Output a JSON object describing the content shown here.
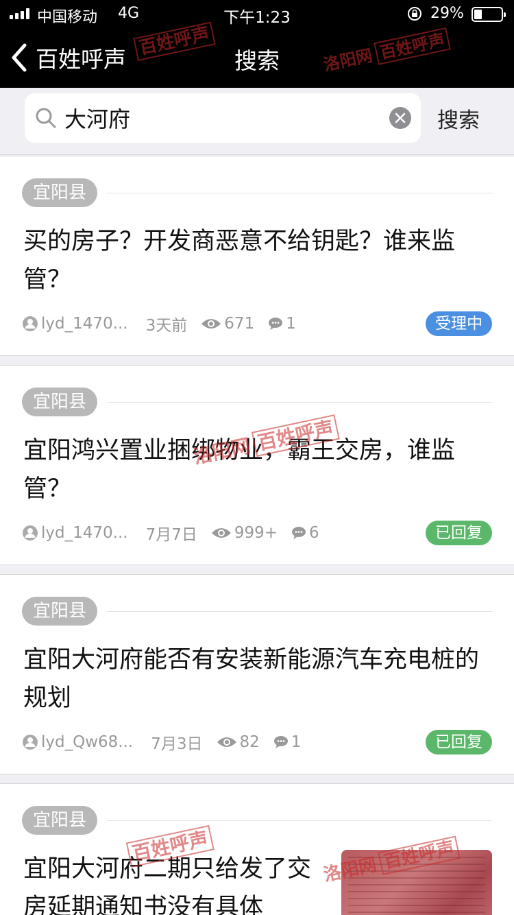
{
  "status_bar": {
    "carrier": "中国移动",
    "network": "4G",
    "time": "下午1:23",
    "battery": "29%",
    "battery_level": 0.29
  },
  "nav": {
    "back_label": "百姓呼声",
    "title": "搜索"
  },
  "search": {
    "query": "大河府",
    "submit_label": "搜索"
  },
  "posts": [
    {
      "region": "宜阳县",
      "title": "买的房子？开发商恶意不给钥匙？谁来监管？",
      "author": "lyd_1470...",
      "time": "3天前",
      "views": "671",
      "comments": "1",
      "status": "受理中",
      "status_color": "#4a8fe0"
    },
    {
      "region": "宜阳县",
      "title": "宜阳鸿兴置业捆绑物业，霸王交房，谁监管？",
      "author": "lyd_1470...",
      "time": "7月7日",
      "views": "999+",
      "comments": "6",
      "status": "已回复",
      "status_color": "#5bb86a"
    },
    {
      "region": "宜阳县",
      "title": "宜阳大河府能否有安装新能源汽车充电桩的规划",
      "author": "lyd_Qw68...",
      "time": "7月3日",
      "views": "82",
      "comments": "1",
      "status": "已回复",
      "status_color": "#5bb86a"
    },
    {
      "region": "宜阳县",
      "title": "宜阳大河府二期只给发了交房延期通知书没有具体"
    }
  ],
  "watermark": {
    "script": "洛阳网",
    "boxed": "百姓呼声"
  },
  "icons": {
    "signal": "signal-bars-icon",
    "rotation_lock": "rotation-lock-icon",
    "battery": "battery-icon",
    "back": "chevron-left-icon",
    "search": "magnifier-icon",
    "clear": "clear-x-icon",
    "author": "user-avatar-icon",
    "views": "eye-icon",
    "comments": "speech-bubble-icon"
  }
}
